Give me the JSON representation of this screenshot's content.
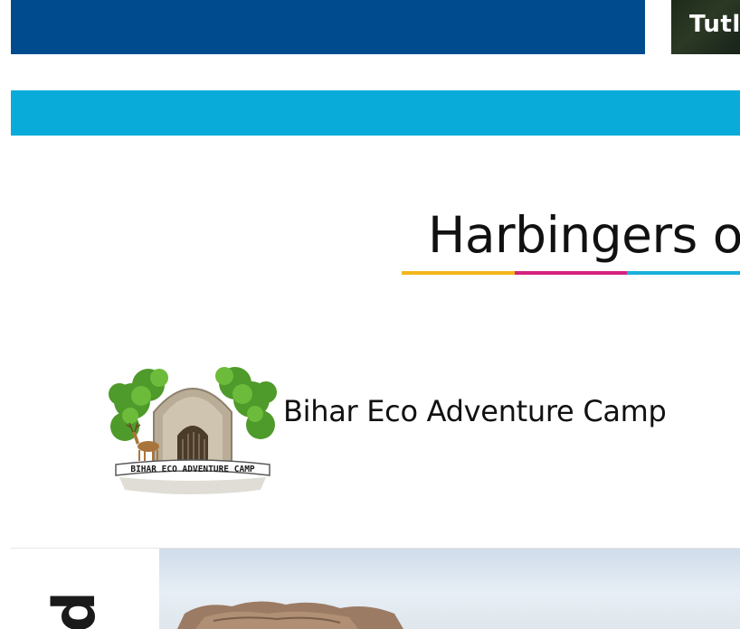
{
  "header": {
    "promo": {
      "text": "Tutl"
    }
  },
  "section": {
    "title": "Harbingers o"
  },
  "partner": {
    "name": "Bihar Eco Adventure Camp",
    "logo_text": "BIHAR ECO ADVENTURE CAMP"
  },
  "card": {
    "letter": "p"
  },
  "colors": {
    "header_blue": "#004b8d",
    "band_cyan": "#09acd9",
    "underline_yellow": "#f2b51a",
    "underline_magenta": "#d4227d",
    "underline_cyan": "#1ab0dc"
  }
}
